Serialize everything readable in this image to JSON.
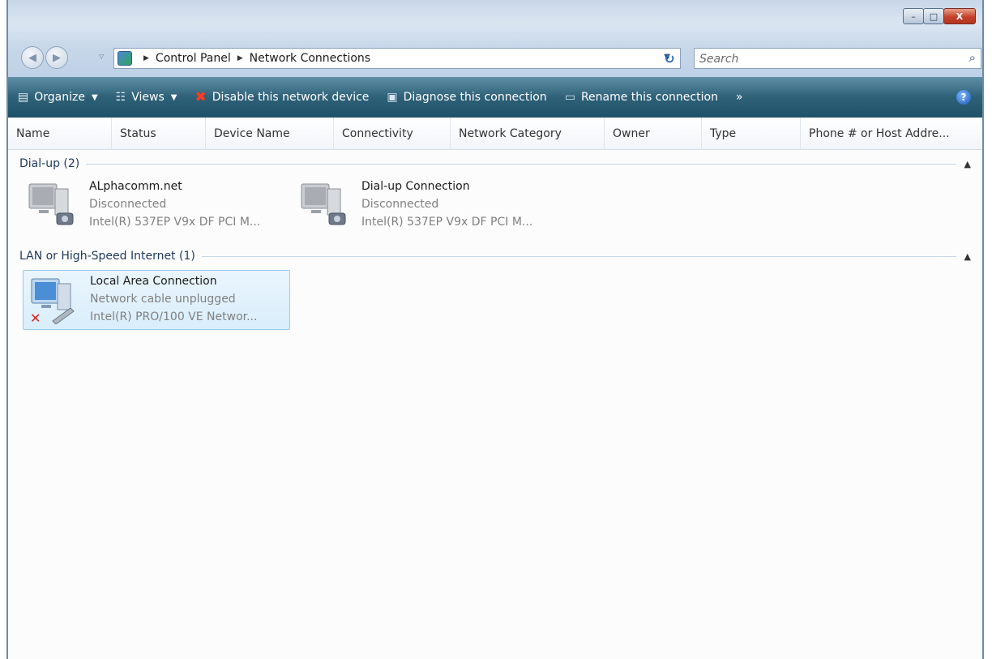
{
  "window": {
    "caption": {
      "minimize": "–",
      "maximize": "□",
      "close": "X"
    }
  },
  "address": {
    "crumbs": [
      "Control Panel",
      "Network Connections"
    ],
    "search_placeholder": "Search"
  },
  "toolbar": {
    "items": [
      {
        "label": "Organize",
        "icon": "organize-icon",
        "dropdown": true
      },
      {
        "label": "Views",
        "icon": "views-icon",
        "dropdown": true
      },
      {
        "label": "Disable this network device",
        "icon": "disable-x-icon"
      },
      {
        "label": "Diagnose this connection",
        "icon": "diagnose-icon"
      },
      {
        "label": "Rename this connection",
        "icon": "rename-icon"
      }
    ],
    "more": "»",
    "help": "?"
  },
  "columns": [
    "Name",
    "Status",
    "Device Name",
    "Connectivity",
    "Network Category",
    "Owner",
    "Type",
    "Phone # or Host Addre..."
  ],
  "groups": [
    {
      "label": "Dial-up (2)",
      "items": [
        {
          "name": "ALphacomm.net",
          "status": "Disconnected",
          "device": "Intel(R) 537EP V9x DF PCI M..."
        },
        {
          "name": "Dial-up Connection",
          "status": "Disconnected",
          "device": "Intel(R) 537EP V9x DF PCI M..."
        }
      ]
    },
    {
      "label": "LAN or High-Speed Internet (1)",
      "items": [
        {
          "name": "Local Area Connection",
          "status": "Network cable unplugged",
          "device": "Intel(R) PRO/100 VE Networ..."
        }
      ]
    }
  ]
}
